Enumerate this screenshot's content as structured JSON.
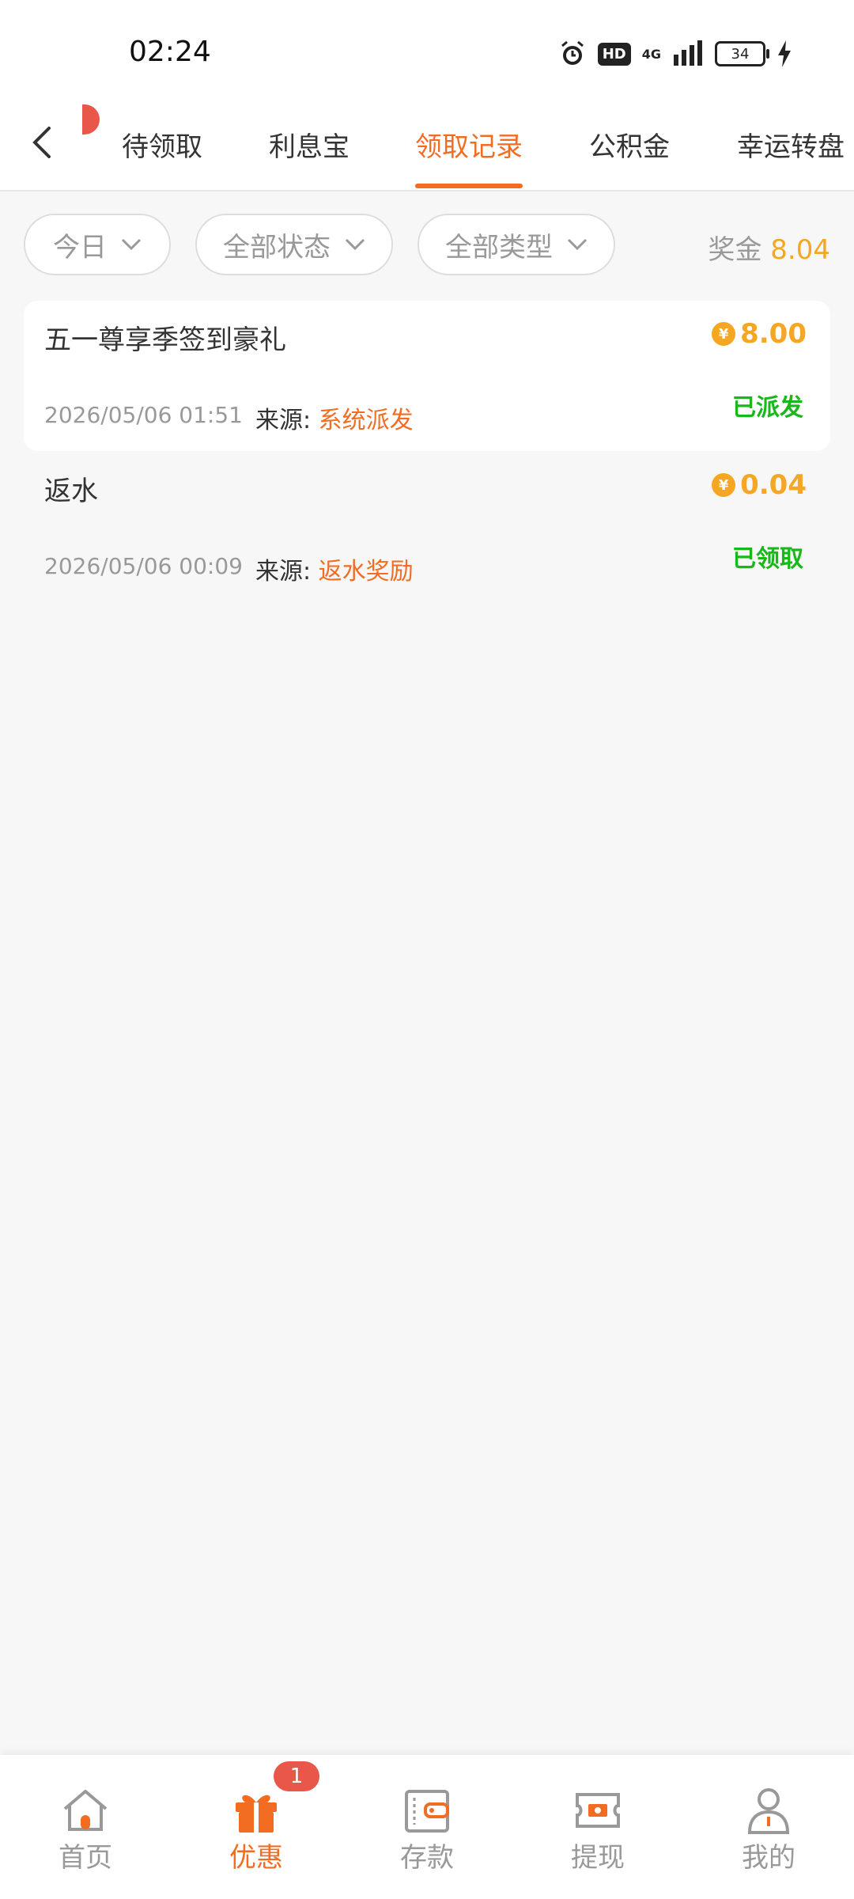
{
  "statusbar": {
    "time": "02:24",
    "hd": "HD",
    "network": "4G",
    "battery": "34"
  },
  "topnav": {
    "tabs": [
      {
        "label": "待领取"
      },
      {
        "label": "利息宝"
      },
      {
        "label": "领取记录",
        "active": true
      },
      {
        "label": "公积金"
      },
      {
        "label": "幸运转盘"
      }
    ]
  },
  "filters": {
    "date": "今日",
    "status": "全部状态",
    "type": "全部类型",
    "bonus_label": "奖金",
    "bonus_value": "8.04"
  },
  "records": [
    {
      "title": "五一尊享季签到豪礼",
      "amount": "8.00",
      "date": "2026/05/06 01:51",
      "source_label": "来源:",
      "source_value": "系统派发",
      "status": "已派发"
    },
    {
      "title": "返水",
      "amount": "0.04",
      "date": "2026/05/06 00:09",
      "source_label": "来源:",
      "source_value": "返水奖励",
      "status": "已领取"
    }
  ],
  "bottomnav": {
    "items": [
      {
        "label": "首页",
        "icon": "home-icon"
      },
      {
        "label": "优惠",
        "icon": "gift-icon",
        "badge": "1",
        "active": true
      },
      {
        "label": "存款",
        "icon": "wallet-icon"
      },
      {
        "label": "提现",
        "icon": "ticket-icon"
      },
      {
        "label": "我的",
        "icon": "user-icon"
      }
    ]
  },
  "colors": {
    "accent": "#f26c22",
    "gold": "#f5a623",
    "green": "#18b81b",
    "badge": "#e9564a"
  }
}
